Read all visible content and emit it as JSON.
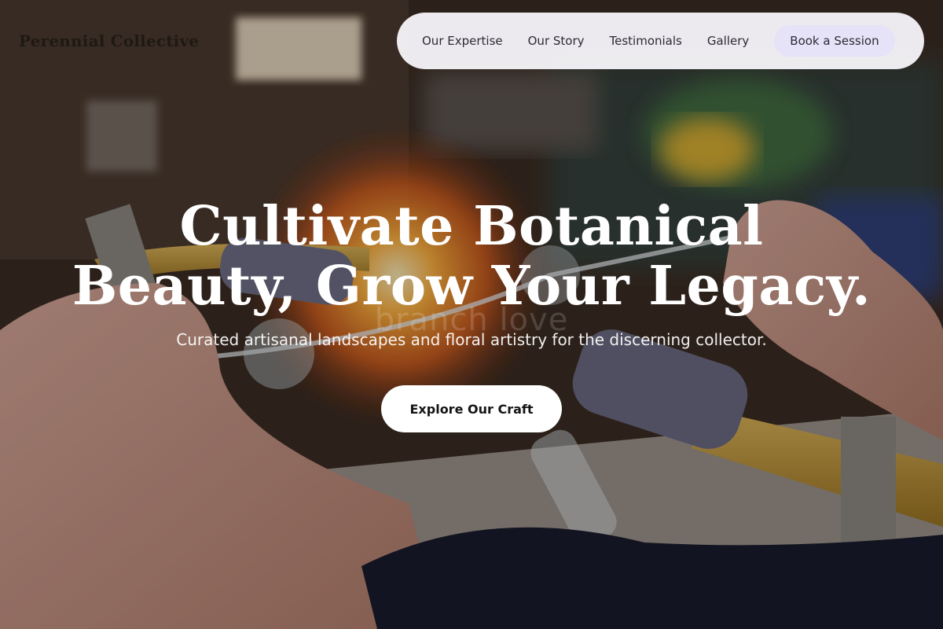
{
  "brand": {
    "name": "Perennial Collective"
  },
  "nav": {
    "links": [
      {
        "label": "Our Expertise"
      },
      {
        "label": "Our Story"
      },
      {
        "label": "Testimonials"
      },
      {
        "label": "Gallery"
      }
    ],
    "cta_label": "Book a Session"
  },
  "hero": {
    "watermark": "branch love",
    "headline_line1": "Cultivate Botanical",
    "headline_line2": "Beauty, Grow Your Legacy.",
    "subheadline": "Curated artisanal landscapes and floral artistry for the discerning collector.",
    "cta_label": "Explore Our Craft"
  },
  "colors": {
    "nav_background": "#f7f6fa",
    "nav_cta_background": "#e6e2f8",
    "cta_background": "#ffffff",
    "headline_text": "#ffffff"
  }
}
